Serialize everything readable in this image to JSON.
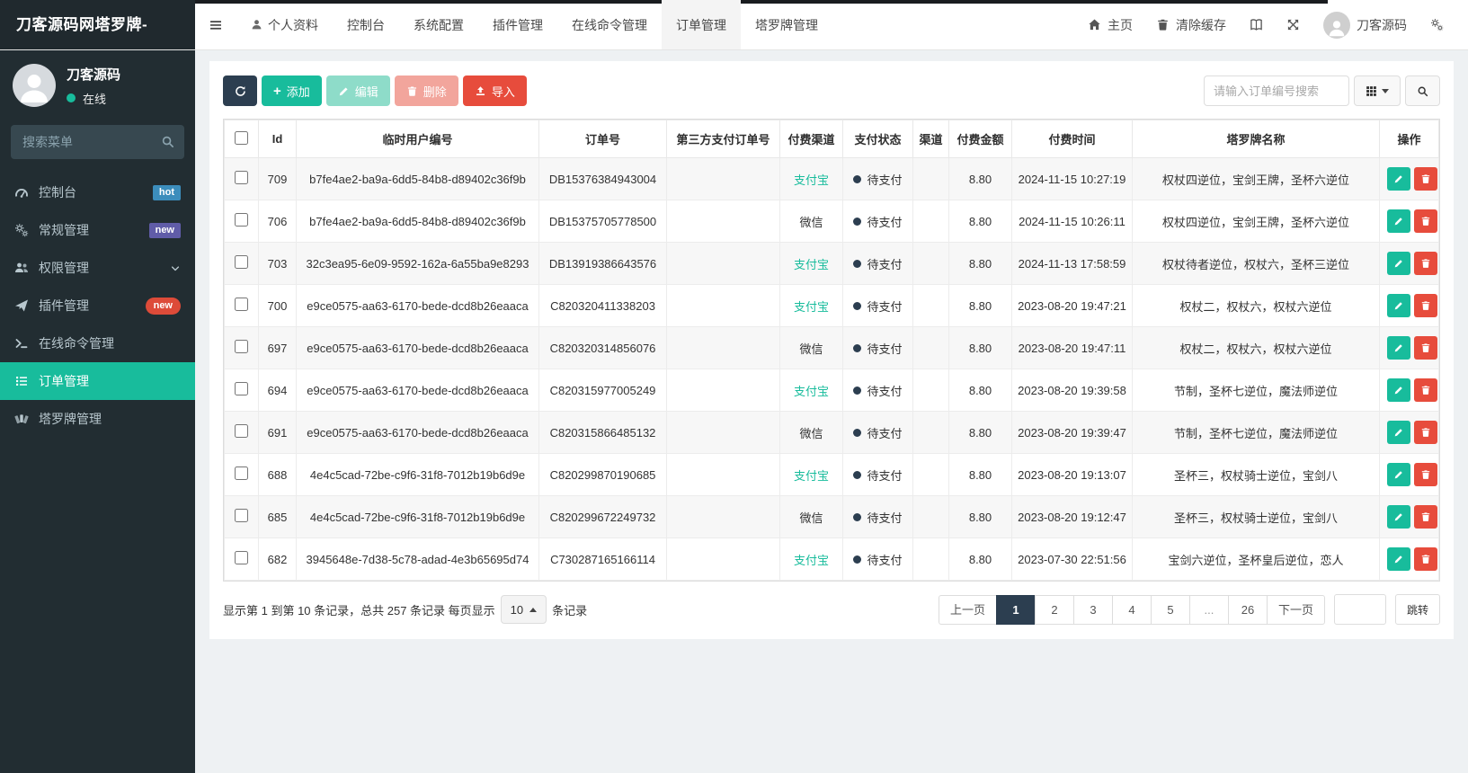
{
  "topbar": {
    "logo": "刀客源码网塔罗牌-",
    "menu": [
      {
        "label": "个人资料",
        "icon": "person"
      },
      {
        "label": "控制台"
      },
      {
        "label": "系统配置"
      },
      {
        "label": "插件管理"
      },
      {
        "label": "在线命令管理"
      },
      {
        "label": "订单管理",
        "active": true
      },
      {
        "label": "塔罗牌管理"
      }
    ],
    "home_label": "主页",
    "clear_cache_label": "清除缓存",
    "username": "刀客源码"
  },
  "sidebar": {
    "username": "刀客源码",
    "status_label": "在线",
    "search_placeholder": "搜索菜单",
    "items": [
      {
        "label": "控制台",
        "icon": "gauge",
        "badge": "hot",
        "badge_color": "#3c8dbc",
        "badge_shape": "square"
      },
      {
        "label": "常规管理",
        "icon": "gears",
        "badge": "new",
        "badge_color": "#605ca8",
        "badge_shape": "square"
      },
      {
        "label": "权限管理",
        "icon": "users",
        "chevron": true
      },
      {
        "label": "插件管理",
        "icon": "plane",
        "badge": "new",
        "badge_color": "#dd4b39",
        "badge_shape": "pill"
      },
      {
        "label": "在线命令管理",
        "icon": "terminal"
      },
      {
        "label": "订单管理",
        "icon": "list",
        "active": true
      },
      {
        "label": "塔罗牌管理",
        "icon": "cards"
      }
    ]
  },
  "toolbar": {
    "add_label": "添加",
    "edit_label": "编辑",
    "delete_label": "删除",
    "import_label": "导入",
    "search_placeholder": "请输入订单编号搜索"
  },
  "table": {
    "columns": [
      "Id",
      "临时用户编号",
      "订单号",
      "第三方支付订单号",
      "付费渠道",
      "支付状态",
      "渠道",
      "付费金额",
      "付费时间",
      "塔罗牌名称",
      "操作"
    ],
    "rows": [
      {
        "id": "709",
        "user_no": "b7fe4ae2-ba9a-6dd5-84b8-d89402c36f9b",
        "order_no": "DB15376384943004",
        "third_no": "",
        "pay_channel": "支付宝",
        "pay_status": "待支付",
        "channel": "",
        "amount": "8.80",
        "pay_time": "2024-11-15 10:27:19",
        "tarot": "权杖四逆位，宝剑王牌，圣杯六逆位"
      },
      {
        "id": "706",
        "user_no": "b7fe4ae2-ba9a-6dd5-84b8-d89402c36f9b",
        "order_no": "DB15375705778500",
        "third_no": "",
        "pay_channel": "微信",
        "pay_status": "待支付",
        "channel": "",
        "amount": "8.80",
        "pay_time": "2024-11-15 10:26:11",
        "tarot": "权杖四逆位，宝剑王牌，圣杯六逆位"
      },
      {
        "id": "703",
        "user_no": "32c3ea95-6e09-9592-162a-6a55ba9e8293",
        "order_no": "DB13919386643576",
        "third_no": "",
        "pay_channel": "支付宝",
        "pay_status": "待支付",
        "channel": "",
        "amount": "8.80",
        "pay_time": "2024-11-13 17:58:59",
        "tarot": "权杖待者逆位，权杖六，圣杯三逆位"
      },
      {
        "id": "700",
        "user_no": "e9ce0575-aa63-6170-bede-dcd8b26eaaca",
        "order_no": "C820320411338203",
        "third_no": "",
        "pay_channel": "支付宝",
        "pay_status": "待支付",
        "channel": "",
        "amount": "8.80",
        "pay_time": "2023-08-20 19:47:21",
        "tarot": "权杖二，权杖六，权杖六逆位"
      },
      {
        "id": "697",
        "user_no": "e9ce0575-aa63-6170-bede-dcd8b26eaaca",
        "order_no": "C820320314856076",
        "third_no": "",
        "pay_channel": "微信",
        "pay_status": "待支付",
        "channel": "",
        "amount": "8.80",
        "pay_time": "2023-08-20 19:47:11",
        "tarot": "权杖二，权杖六，权杖六逆位"
      },
      {
        "id": "694",
        "user_no": "e9ce0575-aa63-6170-bede-dcd8b26eaaca",
        "order_no": "C820315977005249",
        "third_no": "",
        "pay_channel": "支付宝",
        "pay_status": "待支付",
        "channel": "",
        "amount": "8.80",
        "pay_time": "2023-08-20 19:39:58",
        "tarot": "节制，圣杯七逆位，魔法师逆位"
      },
      {
        "id": "691",
        "user_no": "e9ce0575-aa63-6170-bede-dcd8b26eaaca",
        "order_no": "C820315866485132",
        "third_no": "",
        "pay_channel": "微信",
        "pay_status": "待支付",
        "channel": "",
        "amount": "8.80",
        "pay_time": "2023-08-20 19:39:47",
        "tarot": "节制，圣杯七逆位，魔法师逆位"
      },
      {
        "id": "688",
        "user_no": "4e4c5cad-72be-c9f6-31f8-7012b19b6d9e",
        "order_no": "C820299870190685",
        "third_no": "",
        "pay_channel": "支付宝",
        "pay_status": "待支付",
        "channel": "",
        "amount": "8.80",
        "pay_time": "2023-08-20 19:13:07",
        "tarot": "圣杯三，权杖骑士逆位，宝剑八"
      },
      {
        "id": "685",
        "user_no": "4e4c5cad-72be-c9f6-31f8-7012b19b6d9e",
        "order_no": "C820299672249732",
        "third_no": "",
        "pay_channel": "微信",
        "pay_status": "待支付",
        "channel": "",
        "amount": "8.80",
        "pay_time": "2023-08-20 19:12:47",
        "tarot": "圣杯三，权杖骑士逆位，宝剑八"
      },
      {
        "id": "682",
        "user_no": "3945648e-7d38-5c78-adad-4e3b65695d74",
        "order_no": "C730287165166114",
        "third_no": "",
        "pay_channel": "支付宝",
        "pay_status": "待支付",
        "channel": "",
        "amount": "8.80",
        "pay_time": "2023-07-30 22:51:56",
        "tarot": "宝剑六逆位，圣杯皇后逆位，恋人"
      }
    ]
  },
  "footer": {
    "summary_prefix": "显示第 1 到第 10 条记录，总共 257 条记录 每页显示",
    "page_size": "10",
    "summary_suffix": "条记录",
    "pages": [
      {
        "label": "上一页"
      },
      {
        "label": "1",
        "active": true
      },
      {
        "label": "2"
      },
      {
        "label": "3"
      },
      {
        "label": "4"
      },
      {
        "label": "5"
      },
      {
        "label": "...",
        "dots": true
      },
      {
        "label": "26"
      },
      {
        "label": "下一页"
      }
    ],
    "jump_label": "跳转"
  },
  "colors": {
    "accent": "#18bc9c",
    "danger": "#e74c3c",
    "dark": "#2c3e50",
    "sidebar_bg": "#222d32",
    "alipay_text": "#18bc9c"
  }
}
